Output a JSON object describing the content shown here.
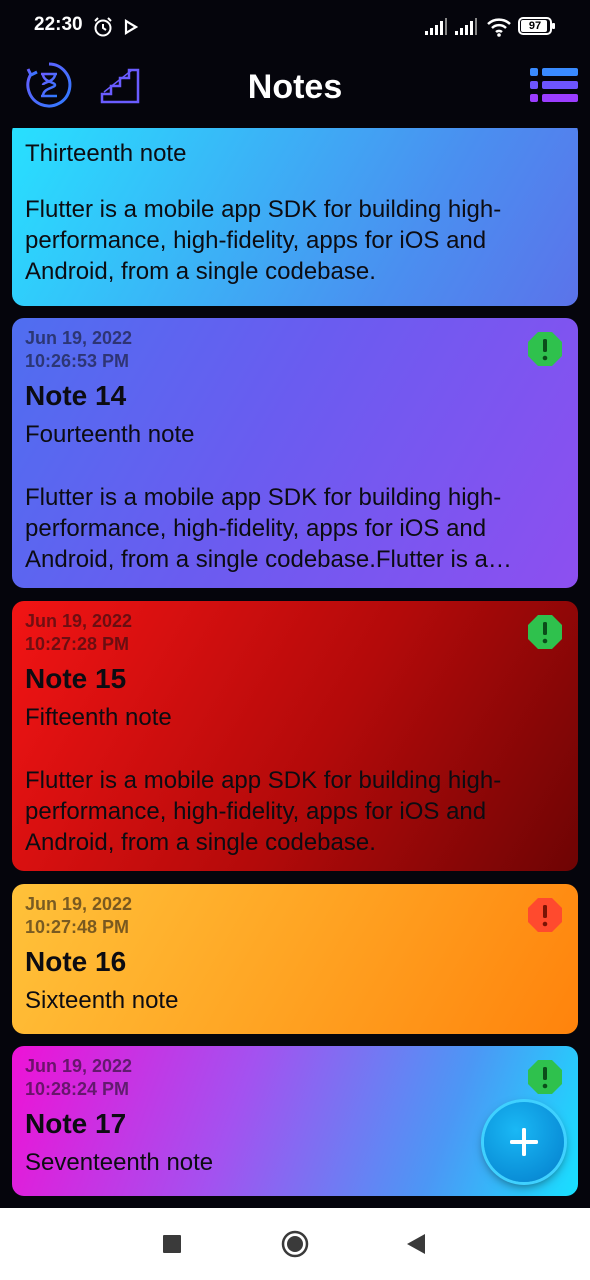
{
  "status_bar": {
    "time": "22:30",
    "battery": "97"
  },
  "app_bar": {
    "title": "Notes"
  },
  "notes": [
    {
      "subtitle": "Thirteenth note",
      "body": "Flutter is a mobile app SDK for building high-performance, high-fidelity, apps for iOS and Android, from a single codebase."
    },
    {
      "date": "Jun 19, 2022",
      "time": "10:26:53 PM",
      "title": "Note 14",
      "subtitle": "Fourteenth note",
      "body": "Flutter is a mobile app SDK for building high-performance, high-fidelity, apps for iOS and Android, from a single codebase.Flutter is a…",
      "badge_color": "#2fc14d"
    },
    {
      "date": "Jun 19, 2022",
      "time": "10:27:28 PM",
      "title": "Note 15",
      "subtitle": "Fifteenth note",
      "body": "Flutter is a mobile app SDK for building high-performance, high-fidelity, apps for iOS and Android, from a single codebase.",
      "badge_color": "#2fc14d"
    },
    {
      "date": "Jun 19, 2022",
      "time": "10:27:48 PM",
      "title": "Note 16",
      "subtitle": "Sixteenth note",
      "badge_color": "#ff3b30"
    },
    {
      "date": "Jun 19, 2022",
      "time": "10:28:24 PM",
      "title": "Note 17",
      "subtitle": "Seventeenth note",
      "badge_color": "#2fc14d"
    }
  ],
  "icons": {
    "status": [
      "alarm-icon",
      "play-icon",
      "signal-icon",
      "wifi-icon",
      "battery-icon"
    ],
    "app_bar": [
      "history-icon",
      "stairs-icon",
      "list-view-icon"
    ],
    "fab": "plus-icon",
    "nav": [
      "recents-icon",
      "home-icon",
      "back-icon"
    ]
  }
}
